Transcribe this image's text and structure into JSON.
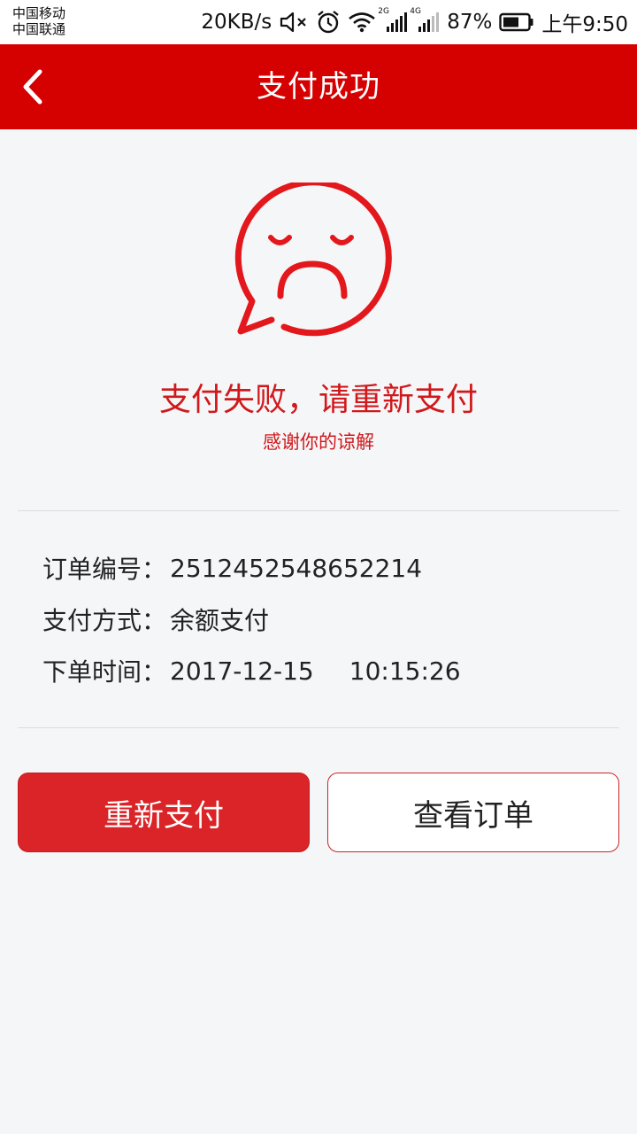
{
  "status_bar": {
    "carrier_1": "中国移动",
    "carrier_2": "中国联通",
    "net_speed": "20KB/s",
    "net_tag_1": "2G",
    "net_tag_2": "4G",
    "battery": "87%",
    "time": "上午9:50"
  },
  "header": {
    "title": "支付成功"
  },
  "result": {
    "title": "支付失败，请重新支付",
    "subtitle": "感谢你的谅解"
  },
  "order": {
    "number_label": "订单编号：",
    "number_value": "2512452548652214",
    "method_label": "支付方式：",
    "method_value": "余额支付",
    "time_label": "下单时间：",
    "date_value": "2017-12-15",
    "time_value": "10:15:26"
  },
  "actions": {
    "retry_label": "重新支付",
    "view_order_label": "查看订单"
  },
  "colors": {
    "brand_red": "#d50000",
    "accent_red": "#d0191c",
    "button_red": "#da2428",
    "background": "#f5f6f8"
  }
}
